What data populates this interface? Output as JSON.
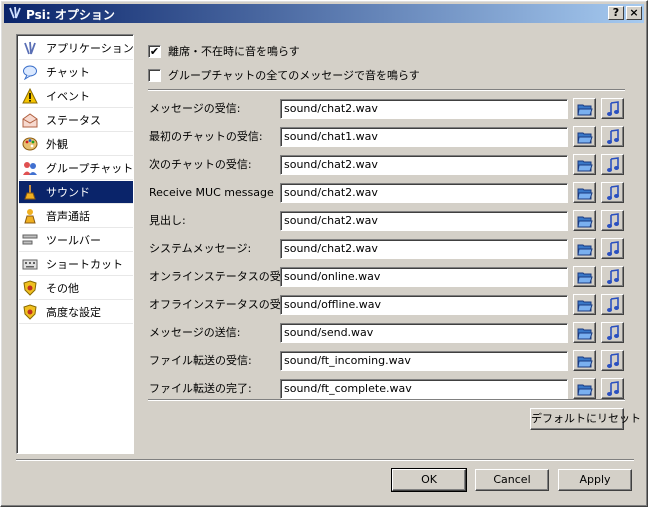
{
  "window": {
    "title": "Psi: オプション",
    "help_label": "?",
    "close_label": "×"
  },
  "sidebar": {
    "items": [
      {
        "label": "アプリケーション",
        "icon": "psi-logo-icon",
        "selected": false
      },
      {
        "label": "チャット",
        "icon": "chat-bubble-icon",
        "selected": false
      },
      {
        "label": "イベント",
        "icon": "warning-icon",
        "selected": false
      },
      {
        "label": "ステータス",
        "icon": "status-envelope-icon",
        "selected": false
      },
      {
        "label": "外観",
        "icon": "palette-icon",
        "selected": false
      },
      {
        "label": "グループチャット",
        "icon": "group-chat-icon",
        "selected": false
      },
      {
        "label": "サウンド",
        "icon": "broom-icon",
        "selected": true
      },
      {
        "label": "音声通話",
        "icon": "voice-call-icon",
        "selected": false
      },
      {
        "label": "ツールバー",
        "icon": "toolbar-icon",
        "selected": false
      },
      {
        "label": "ショートカット",
        "icon": "keyboard-icon",
        "selected": false
      },
      {
        "label": "その他",
        "icon": "shield-icon",
        "selected": false
      },
      {
        "label": "高度な設定",
        "icon": "shield-advanced-icon",
        "selected": false
      }
    ]
  },
  "options": {
    "mute_when_away": {
      "label": "離席・不在時に音を鳴らす",
      "checked": true,
      "mark": "✔"
    },
    "groupchat_all_messages": {
      "label": "グループチャットの全てのメッセージで音を鳴らす",
      "checked": false,
      "mark": ""
    }
  },
  "sounds": [
    {
      "label": "メッセージの受信:",
      "value": "sound/chat2.wav"
    },
    {
      "label": "最初のチャットの受信:",
      "value": "sound/chat1.wav"
    },
    {
      "label": "次のチャットの受信:",
      "value": "sound/chat2.wav"
    },
    {
      "label": "Receive MUC message",
      "value": "sound/chat2.wav"
    },
    {
      "label": "見出し:",
      "value": "sound/chat2.wav"
    },
    {
      "label": "システムメッセージ:",
      "value": "sound/chat2.wav"
    },
    {
      "label": "オンラインステータスの受信:",
      "value": "sound/online.wav"
    },
    {
      "label": "オフラインステータスの受信:",
      "value": "sound/offline.wav"
    },
    {
      "label": "メッセージの送信:",
      "value": "sound/send.wav"
    },
    {
      "label": "ファイル転送の受信:",
      "value": "sound/ft_incoming.wav"
    },
    {
      "label": "ファイル転送の完了:",
      "value": "sound/ft_complete.wav"
    }
  ],
  "buttons": {
    "reset": "デフォルトにリセット",
    "ok": "OK",
    "cancel": "Cancel",
    "apply": "Apply"
  },
  "colors": {
    "title_start": "#0a246a",
    "title_end": "#a6caf0",
    "selection": "#0a246a",
    "face": "#d4d0c8"
  },
  "icons": {
    "browse": "folder-open-icon",
    "play": "music-note-icon"
  }
}
